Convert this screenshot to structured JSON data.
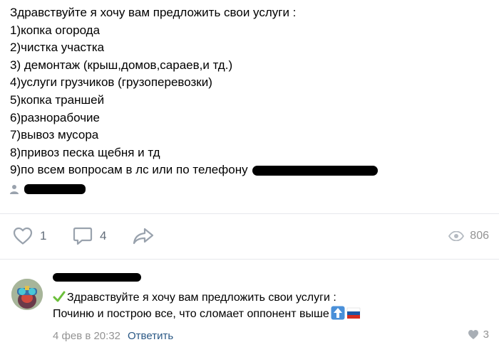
{
  "post": {
    "lines": [
      "Здравствуйте я хочу вам предложить свои услуги :",
      "1)копка огорода",
      "2)чистка участка",
      "3) демонтаж (крыш,домов,сараев,и тд.)",
      "4)услуги грузчиков (грузоперевозки)",
      "5)копка траншей",
      "6)разнорабочие",
      "7)вывоз мусора",
      "8)привоз песка щебня и тд",
      "9)по всем вопросам в лс или по телефону"
    ],
    "icons": {
      "author": "person-icon"
    }
  },
  "actions": {
    "like_count": "1",
    "comment_count": "4",
    "views_count": "806",
    "icons": {
      "like": "heart-icon",
      "comment": "comment-icon",
      "share": "share-icon",
      "views": "eye-icon"
    }
  },
  "comment": {
    "line1": "Здравствуйте я хочу вам предложить свои услуги :",
    "line2": "Починю и построю все, что сломает оппонент выше",
    "date": "4 фев в 20:32",
    "reply_label": "Ответить",
    "like_count": "3",
    "icons": {
      "check": "check-mark-icon",
      "up_arrow": "up-arrow-emoji-icon",
      "flag": "russia-flag-icon",
      "like": "heart-icon"
    }
  },
  "colors": {
    "icon_blue": "#99a2ad",
    "meta_gray": "#939393",
    "link_blue": "#2a5885",
    "check_green": "#6bbf3a",
    "divider": "#e7e8ec"
  }
}
